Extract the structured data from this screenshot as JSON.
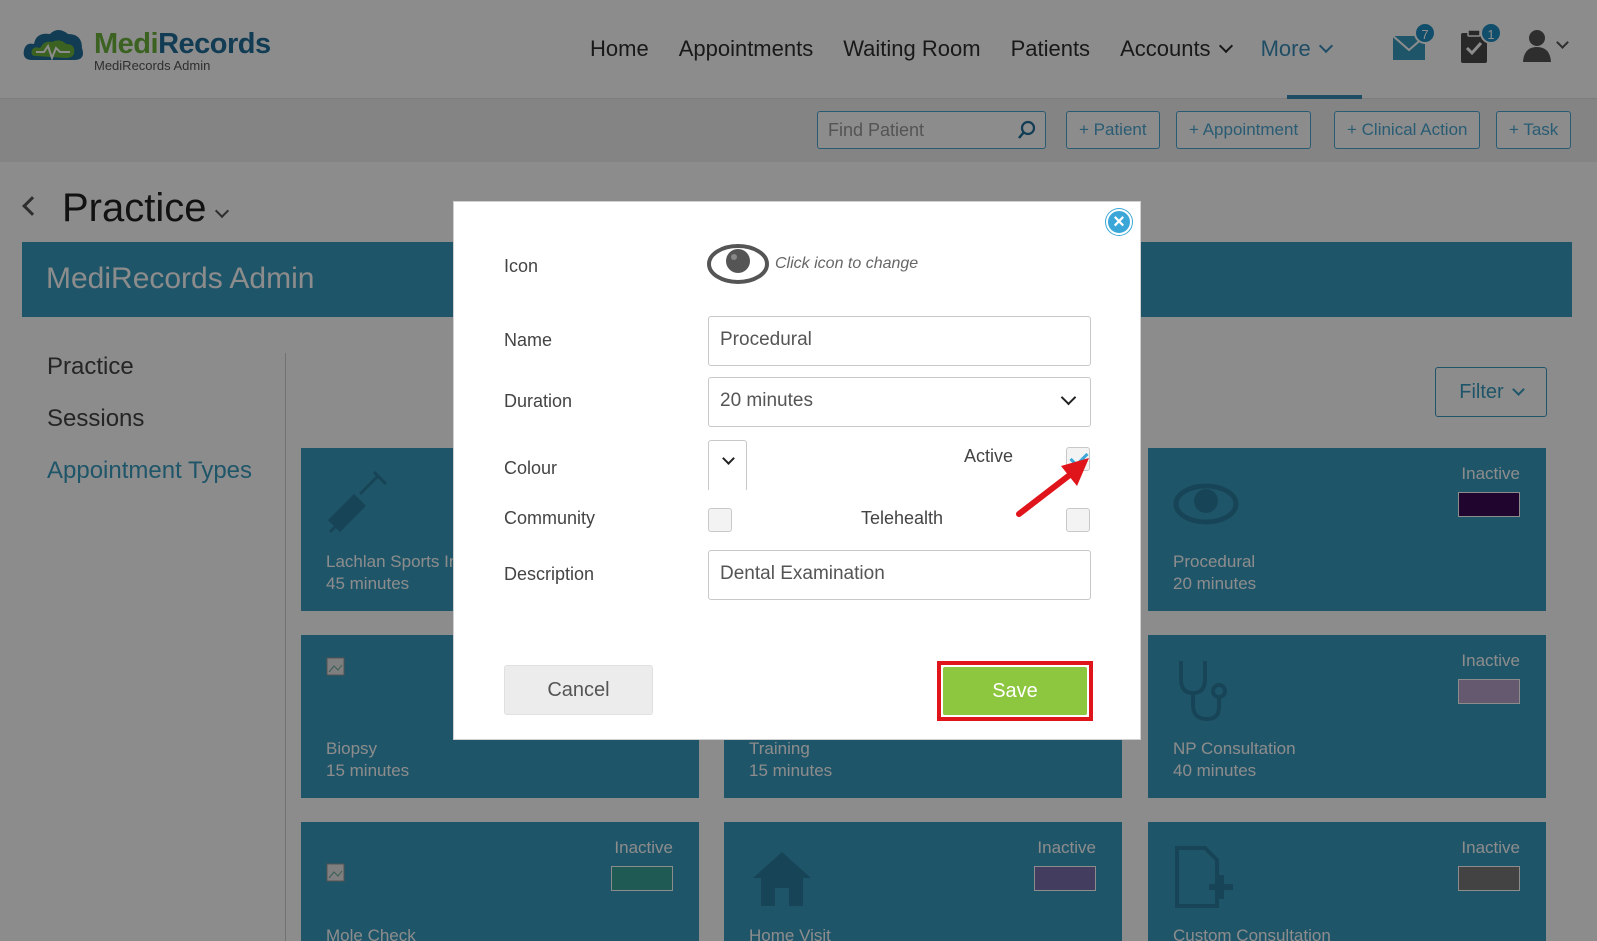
{
  "header": {
    "logo_brand_a": "Medi",
    "logo_brand_b": "Records",
    "logo_sub": "MediRecords Admin",
    "nav": [
      {
        "label": "Home"
      },
      {
        "label": "Appointments"
      },
      {
        "label": "Waiting Room"
      },
      {
        "label": "Patients"
      },
      {
        "label": "Accounts"
      },
      {
        "label": "More"
      }
    ],
    "active_nav": "More",
    "messages_badge": "7",
    "tasks_badge": "1",
    "accent_color": "#3a8db8"
  },
  "actionbar": {
    "search_placeholder": "Find Patient",
    "buttons": [
      "+ Patient",
      "+ Appointment",
      "+ Clinical Action",
      "+ Task"
    ]
  },
  "page": {
    "title": "Practice",
    "banner": "MediRecords Admin",
    "sidenav": [
      "Practice",
      "Sessions",
      "Appointment Types"
    ],
    "sidenav_active": "Appointment Types",
    "filter_label": "Filter"
  },
  "cards": [
    {
      "name": "Lachlan Sports Injury",
      "duration": "45 minutes",
      "status": "",
      "icon": "syringe-icon"
    },
    {
      "name": "Procedural",
      "duration": "20 minutes",
      "status": "Inactive",
      "swatch": "#3b0a57",
      "icon": "eye-icon"
    },
    {
      "name": "Biopsy",
      "duration": "15 minutes",
      "status": "",
      "icon": "broken-image-icon"
    },
    {
      "name": "Training",
      "duration": "15 minutes",
      "status": "",
      "icon": ""
    },
    {
      "name": "NP Consultation",
      "duration": "40 minutes",
      "status": "Inactive",
      "swatch": "#b8a2cc",
      "icon": "stethoscope-icon"
    },
    {
      "name": "Mole Check",
      "duration": "",
      "status": "Inactive",
      "swatch": "#3aa59a",
      "icon": "broken-image-icon"
    },
    {
      "name": "Home Visit",
      "duration": "",
      "status": "Inactive",
      "swatch": "#7b6fae",
      "icon": "house-icon"
    },
    {
      "name": "Custom Consultation",
      "duration": "",
      "status": "Inactive",
      "swatch": "#7a7a7a",
      "icon": "file-plus-icon"
    }
  ],
  "modal": {
    "icon_label": "Icon",
    "icon_hint": "Click icon to change",
    "name_label": "Name",
    "name_value": "Procedural",
    "duration_label": "Duration",
    "duration_value": "20 minutes",
    "colour_label": "Colour",
    "active_label": "Active",
    "active_checked": true,
    "community_label": "Community",
    "community_checked": false,
    "telehealth_label": "Telehealth",
    "telehealth_checked": false,
    "description_label": "Description",
    "description_value": "Dental Examination",
    "cancel_label": "Cancel",
    "save_label": "Save",
    "save_color": "#8dc63f",
    "highlight_color": "#e0141b"
  }
}
